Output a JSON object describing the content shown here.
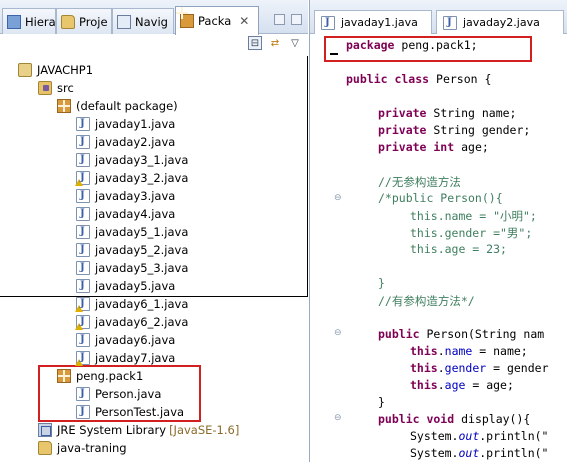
{
  "left_tabs": [
    {
      "label": "Hierar"
    },
    {
      "label": "Proje"
    },
    {
      "label": "Navig"
    },
    {
      "label": "Packa",
      "close": "✕"
    }
  ],
  "tree": {
    "project": "JAVACHP1",
    "src": "src",
    "default_package": "(default package)",
    "default_files": [
      {
        "name": "javaday1.java",
        "warn": false
      },
      {
        "name": "javaday2.java",
        "warn": false
      },
      {
        "name": "javaday3_1.java",
        "warn": false
      },
      {
        "name": "javaday3_2.java",
        "warn": true
      },
      {
        "name": "javaday3.java",
        "warn": false
      },
      {
        "name": "javaday4.java",
        "warn": false
      },
      {
        "name": "javaday5_1.java",
        "warn": false
      },
      {
        "name": "javaday5_2.java",
        "warn": false
      },
      {
        "name": "javaday5_3.java",
        "warn": false
      },
      {
        "name": "javaday5.java",
        "warn": false
      },
      {
        "name": "javaday6_1.java",
        "warn": true
      },
      {
        "name": "javaday6_2.java",
        "warn": true
      },
      {
        "name": "javaday6.java",
        "warn": false
      },
      {
        "name": "javaday7.java",
        "warn": true
      }
    ],
    "package": "peng.pack1",
    "package_files": [
      {
        "name": "Person.java"
      },
      {
        "name": "PersonTest.java"
      }
    ],
    "jre_label": "JRE System Library",
    "jre_version": "[JavaSE-1.6]",
    "project2": "java-traning"
  },
  "editor_tabs": [
    {
      "label": "javaday1.java"
    },
    {
      "label": "javaday2.java"
    }
  ],
  "code": {
    "l1": {
      "k": "package",
      "t": " peng.pack1;"
    },
    "l2": {
      "k": "public class",
      "t": " Person {"
    },
    "l3": {
      "k": "private",
      "t": " String name;"
    },
    "l4": {
      "k": "private",
      "t": " String gender;"
    },
    "l5": {
      "k": "private int",
      "t": " age;"
    },
    "l6": "//无参构造方法",
    "l7": "/*public Person(){",
    "l8": "this.name = \"小明\";",
    "l9": "this.gender =\"男\";",
    "l10": "this.age = 23;",
    "l11": "}",
    "l12": "//有参构造方法*/",
    "l13": {
      "k": "public",
      "t": " Person(String nam"
    },
    "l14": {
      "k": "this",
      "f": "name",
      "t": " = name;"
    },
    "l15": {
      "k": "this",
      "f": "gender",
      "t": " = gender"
    },
    "l16": {
      "k": "this",
      "f": "age",
      "t": " = age;"
    },
    "l17": "}",
    "l18": {
      "k": "public void",
      "t": " display(){"
    },
    "l19": {
      "a": "System.",
      "i": "out",
      "b": ".println(\""
    },
    "l20": {
      "a": "System.",
      "i": "out",
      "b": ".println(\""
    }
  },
  "colors": {
    "highlight_box": "#d21f1f",
    "keyword": "#7f0055",
    "comment": "#3f7f5f",
    "field": "#0000c0"
  }
}
